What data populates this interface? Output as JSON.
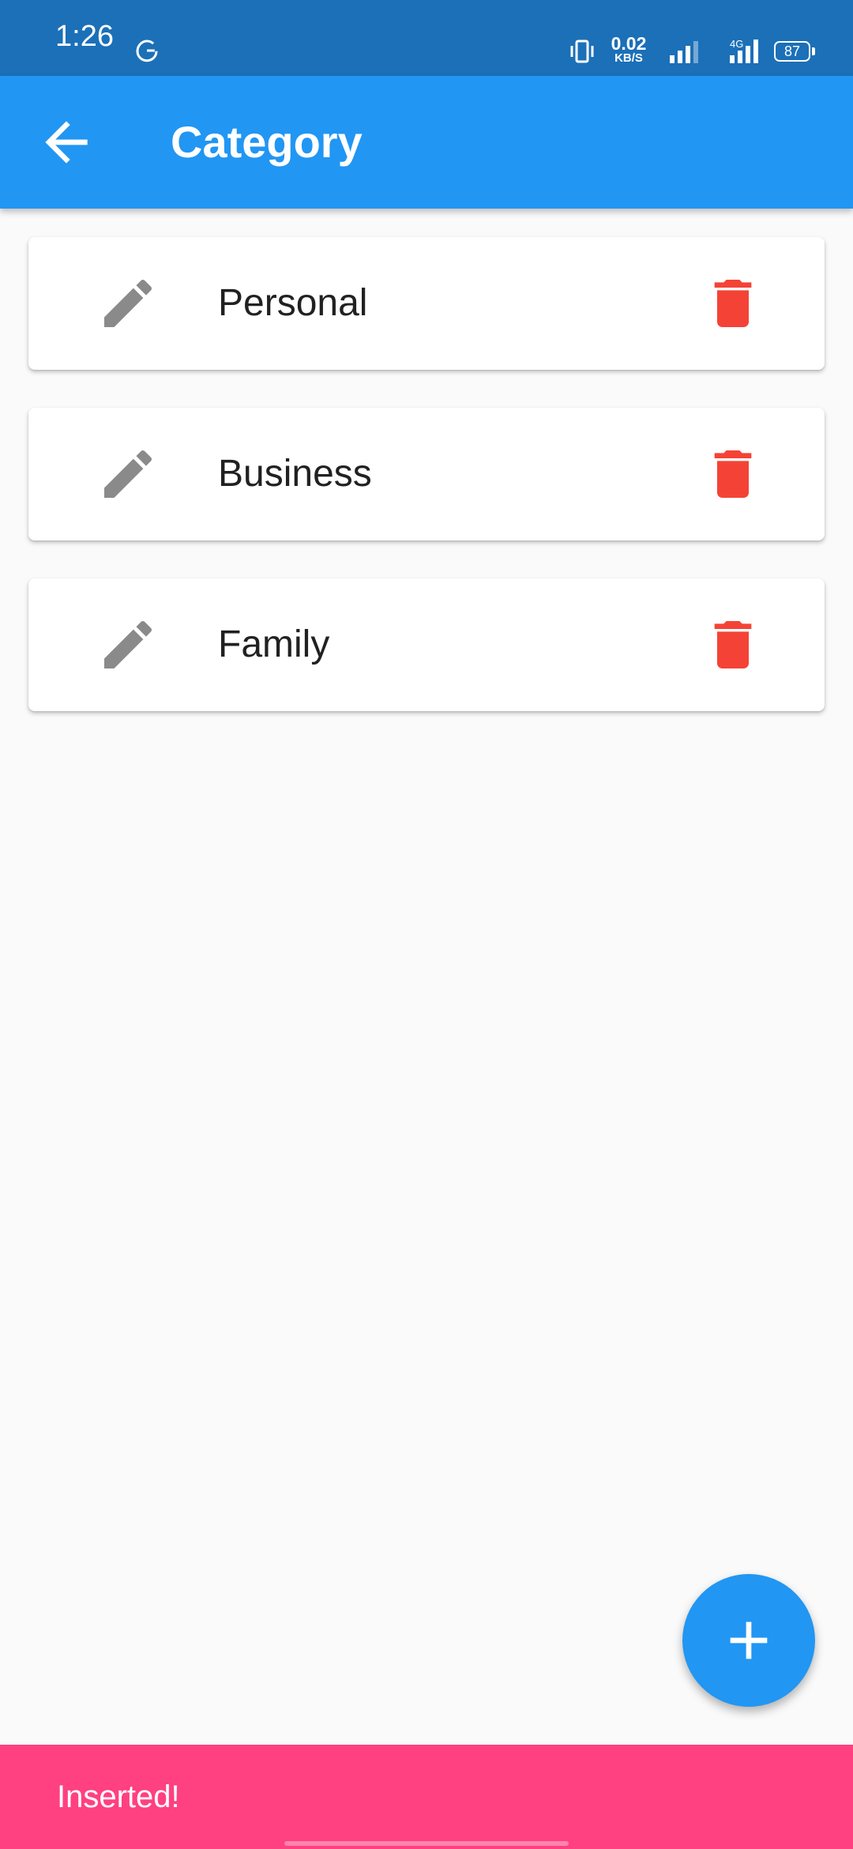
{
  "status_bar": {
    "time": "1:26",
    "net_speed_value": "0.02",
    "net_speed_unit": "KB/S",
    "network_type": "4G",
    "battery_level": "87",
    "icons": [
      "g-icon",
      "vibrate-icon",
      "signal-icon",
      "signal-4g-icon",
      "battery-icon"
    ]
  },
  "app_bar": {
    "title": "Category",
    "back_icon": "arrow-back-icon"
  },
  "categories": [
    {
      "label": "Personal"
    },
    {
      "label": "Business"
    },
    {
      "label": "Family"
    }
  ],
  "item_icons": {
    "edit": "pencil-icon",
    "delete": "trash-icon"
  },
  "fab": {
    "icon": "plus-icon"
  },
  "snackbar": {
    "message": "Inserted!"
  },
  "colors": {
    "status_bar": "#1b70b8",
    "app_bar": "#2196f3",
    "edit_icon": "#8a8a8a",
    "delete_icon": "#f44336",
    "fab": "#2196f3",
    "snackbar": "#ff4081",
    "background": "#fafafa"
  }
}
